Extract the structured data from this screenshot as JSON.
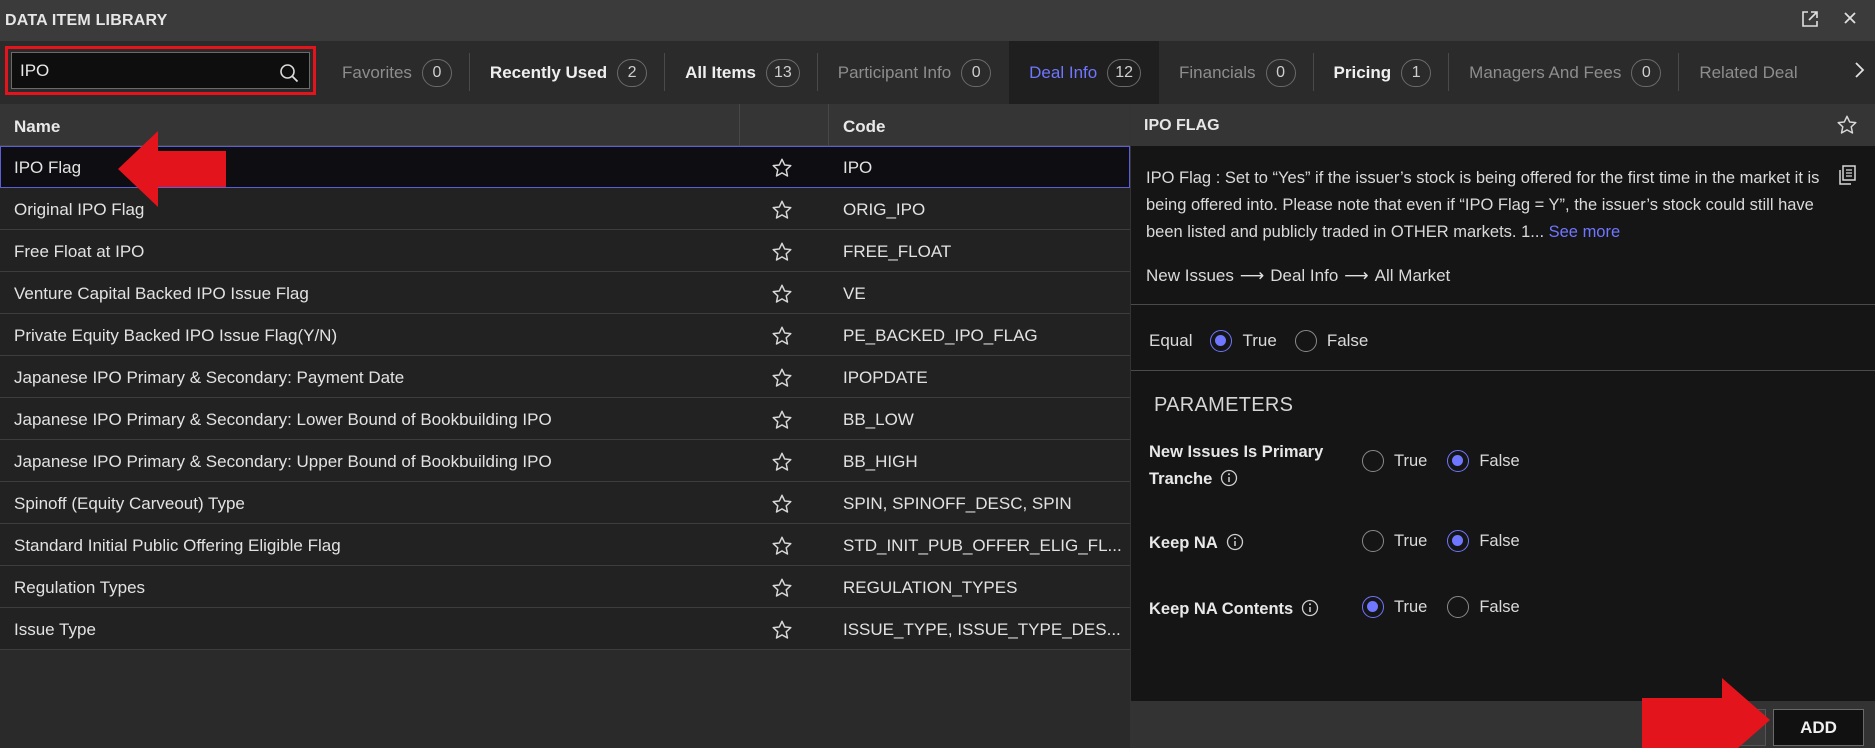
{
  "window": {
    "title": "DATA ITEM LIBRARY",
    "icons": [
      "popout-icon",
      "close-icon"
    ]
  },
  "search": {
    "value": "IPO",
    "placeholder": ""
  },
  "tabs": [
    {
      "label": "Favorites",
      "count": "0"
    },
    {
      "label": "Recently Used",
      "count": "2"
    },
    {
      "label": "All Items",
      "count": "13"
    },
    {
      "label": "Participant Info",
      "count": "0"
    },
    {
      "label": "Deal Info",
      "count": "12"
    },
    {
      "label": "Financials",
      "count": "0"
    },
    {
      "label": "Pricing",
      "count": "1"
    },
    {
      "label": "Managers And Fees",
      "count": "0"
    },
    {
      "label": "Related Deal"
    }
  ],
  "table": {
    "headers": {
      "name": "Name",
      "code": "Code"
    },
    "rows": [
      {
        "name": "IPO Flag",
        "code": "IPO"
      },
      {
        "name": "Original IPO Flag",
        "code": "ORIG_IPO"
      },
      {
        "name": "Free Float at IPO",
        "code": "FREE_FLOAT"
      },
      {
        "name": "Venture Capital Backed IPO Issue Flag",
        "code": "VE"
      },
      {
        "name": "Private Equity Backed IPO Issue Flag(Y/N)",
        "code": "PE_BACKED_IPO_FLAG"
      },
      {
        "name": "Japanese IPO Primary & Secondary: Payment Date",
        "code": "IPOPDATE"
      },
      {
        "name": "Japanese IPO Primary & Secondary: Lower Bound of Bookbuilding IPO",
        "code": "BB_LOW"
      },
      {
        "name": "Japanese IPO Primary & Secondary: Upper Bound of Bookbuilding IPO",
        "code": "BB_HIGH"
      },
      {
        "name": "Spinoff (Equity Carveout) Type",
        "code": "SPIN, SPINOFF_DESC, SPIN"
      },
      {
        "name": "Standard Initial Public Offering Eligible Flag",
        "code": "STD_INIT_PUB_OFFER_ELIG_FL..."
      },
      {
        "name": "Regulation Types",
        "code": "REGULATION_TYPES"
      },
      {
        "name": "Issue Type",
        "code": "ISSUE_TYPE, ISSUE_TYPE_DES..."
      }
    ]
  },
  "detail": {
    "title": "IPO FLAG",
    "description": "IPO Flag : Set to “Yes” if the issuer’s stock is being offered for the first time in the market it is being offered into. Please note that even if “IPO Flag = Y”, the issuer’s stock could still have been listed and publicly traded in OTHER markets. 1...",
    "see_more": "See more",
    "breadcrumb": [
      "New Issues",
      "Deal Info",
      "All Market"
    ],
    "equal_label": "Equal",
    "true_label": "True",
    "false_label": "False",
    "equal_value": "True",
    "parameters_title": "PARAMETERS",
    "parameters": [
      {
        "label_line1": "New Issues Is Primary",
        "label_line2": "Tranche",
        "value": "False"
      },
      {
        "label_line1": "Keep NA",
        "label_line2": "",
        "value": "False"
      },
      {
        "label_line1": "Keep NA Contents",
        "label_line2": "",
        "value": "True"
      }
    ],
    "add_label": "ADD"
  },
  "colors": {
    "accent": "#6f76ff",
    "annotation_red": "#e3141b"
  }
}
